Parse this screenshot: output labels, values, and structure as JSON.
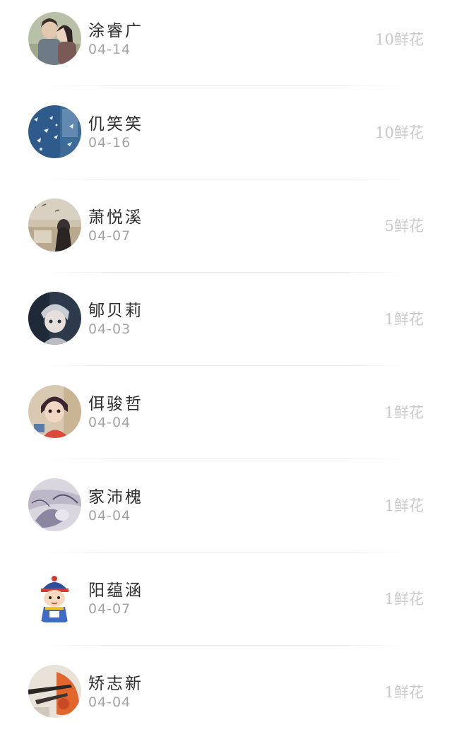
{
  "flower_list": [
    {
      "name": "涂睿广",
      "date": "04-14",
      "flowers": "10鲜花",
      "avatar": "couple-photo-avatar"
    },
    {
      "name": "仉笑笑",
      "date": "04-16",
      "flowers": "10鲜花",
      "avatar": "blue-sky-avatar"
    },
    {
      "name": "萧悦溪",
      "date": "04-07",
      "flowers": "5鲜花",
      "avatar": "girl-scenery-avatar"
    },
    {
      "name": "郇贝莉",
      "date": "04-03",
      "flowers": "1鲜花",
      "avatar": "anime-boy-avatar"
    },
    {
      "name": "佴骏哲",
      "date": "04-04",
      "flowers": "1鲜花",
      "avatar": "child-photo-avatar"
    },
    {
      "name": "家沛槐",
      "date": "04-04",
      "flowers": "1鲜花",
      "avatar": "sketch-avatar"
    },
    {
      "name": "阳蕴涵",
      "date": "04-07",
      "flowers": "1鲜花",
      "avatar": "cartoon-boy-avatar"
    },
    {
      "name": "矫志新",
      "date": "04-04",
      "flowers": "1鲜花",
      "avatar": "orange-photo-avatar"
    }
  ]
}
